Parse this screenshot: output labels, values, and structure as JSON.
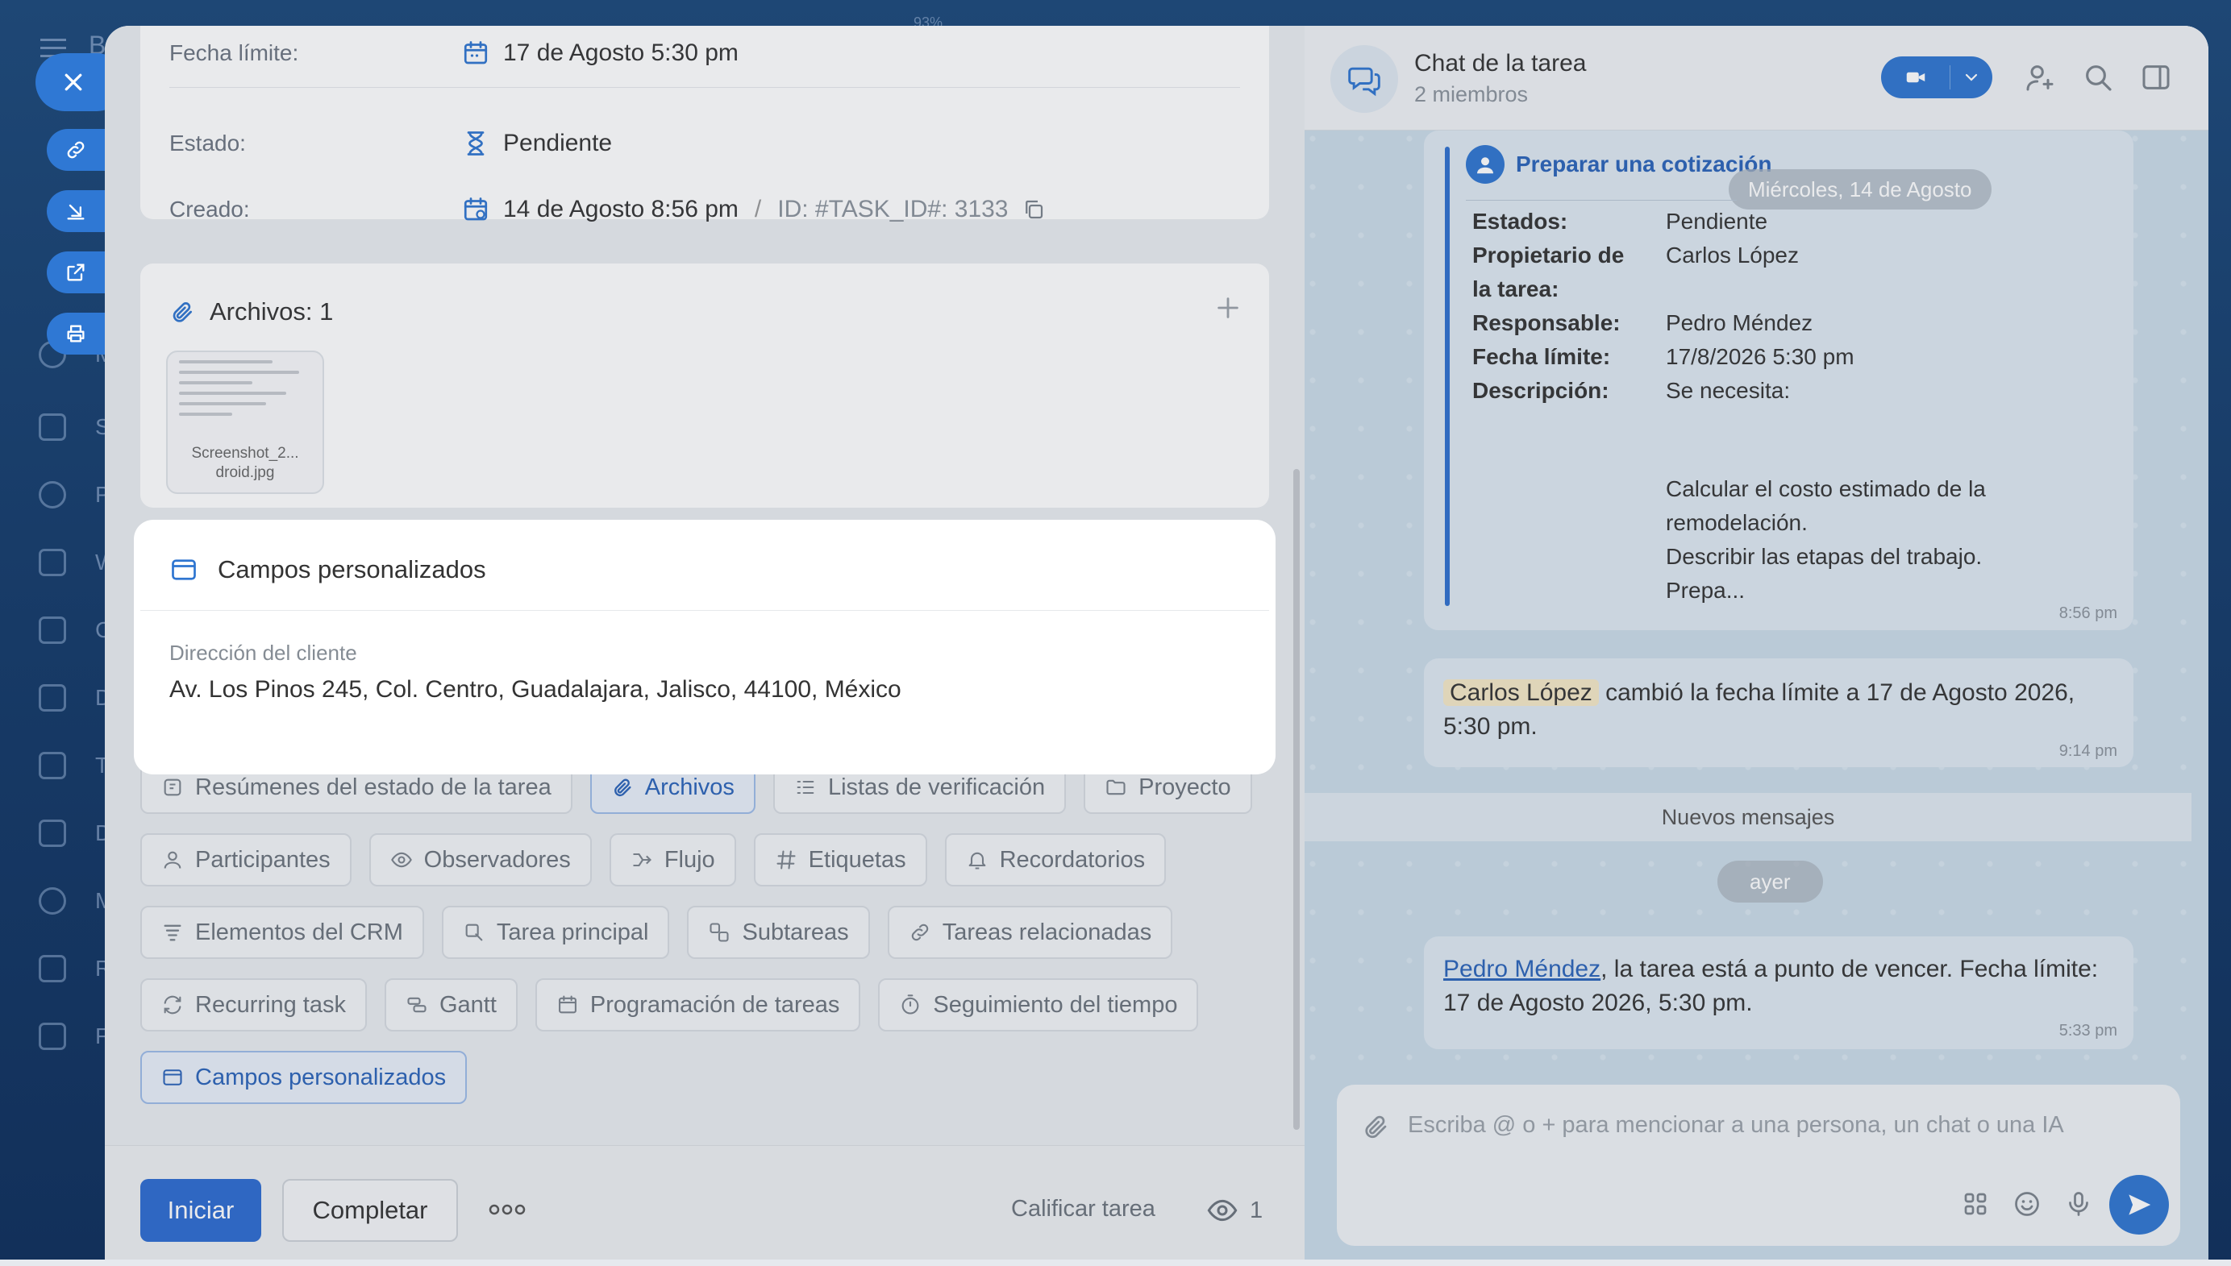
{
  "background": {
    "app_initial": "B",
    "zoom": "93%",
    "nav_letters": [
      "M",
      "S",
      "P",
      "W",
      "C",
      "D",
      "T",
      "D",
      "M",
      "R",
      "F"
    ]
  },
  "task": {
    "info": {
      "deadline_label": "Fecha límite:",
      "deadline_value": "17 de Agosto 5:30 pm",
      "status_label": "Estado:",
      "status_value": "Pendiente",
      "created_label": "Creado:",
      "created_value": "14 de Agosto 8:56 pm",
      "id_sep": "/",
      "id_value": "ID: #TASK_ID#: 3133"
    },
    "files": {
      "title": "Archivos: 1",
      "file_name_1": "Screenshot_2...",
      "file_name_2": "droid.jpg"
    },
    "custom_fields": {
      "title": "Campos personalizados",
      "field_label": "Dirección del cliente",
      "field_value": "Av. Los Pinos 245, Col. Centro, Guadalajara, Jalisco, 44100, México"
    },
    "chips": [
      [
        "Resúmenes del estado de la tarea",
        "Archivos",
        "Listas de verificación",
        "Proyecto"
      ],
      [
        "Participantes",
        "Observadores",
        "Flujo",
        "Etiquetas",
        "Recordatorios"
      ],
      [
        "Elementos del CRM",
        "Tarea principal",
        "Subtareas",
        "Tareas relacionadas"
      ],
      [
        "Recurring task",
        "Gantt",
        "Programación de tareas",
        "Seguimiento del tiempo"
      ],
      [
        "Campos personalizados"
      ]
    ],
    "footer": {
      "start": "Iniciar",
      "complete": "Completar",
      "rate": "Calificar tarea",
      "viewers": "1"
    }
  },
  "chat": {
    "title": "Chat de la tarea",
    "members": "2 miembros",
    "date_pill_top": "Miércoles, 14 de Agosto",
    "task_card": {
      "title": "Preparar una cotización",
      "estados_label": "Estados:",
      "estados_value": "Pendiente",
      "owner_label_1": "Propietario de",
      "owner_label_2": "la tarea:",
      "owner_value": "Carlos López",
      "responsible_label": "Responsable:",
      "responsible_value": "Pedro Méndez",
      "deadline_label": "Fecha límite:",
      "deadline_value": "17/8/2026 5:30 pm",
      "desc_label": "Descripción:",
      "desc_line1": "Se necesita:",
      "desc_line2": "Calcular el costo estimado de la",
      "desc_line3": "remodelación.",
      "desc_line4": "Describir las etapas del trabajo.",
      "desc_line5": "Prepa...",
      "time": "8:56 pm"
    },
    "change_msg": {
      "user": "Carlos López",
      "text_1": " cambió la fecha límite a 17 de Agosto 2026,",
      "text_2": "5:30 pm.",
      "time": "9:14 pm"
    },
    "new_messages": "Nuevos mensajes",
    "date_pill_yesterday": "ayer",
    "reminder_msg": {
      "user": "Pedro Méndez",
      "text_1": ", la tarea está a punto de vencer. Fecha límite:",
      "text_2": "17 de Agosto 2026, 5:30 pm.",
      "time": "5:33 pm"
    },
    "input_placeholder": "Escriba @ o + para mencionar a una persona, un chat o una IA"
  },
  "colors": {
    "accent": "#2e75d0",
    "accent_dark": "#2c6ad0",
    "link": "#2a62b8",
    "chat_bg": "#cadbe8"
  }
}
